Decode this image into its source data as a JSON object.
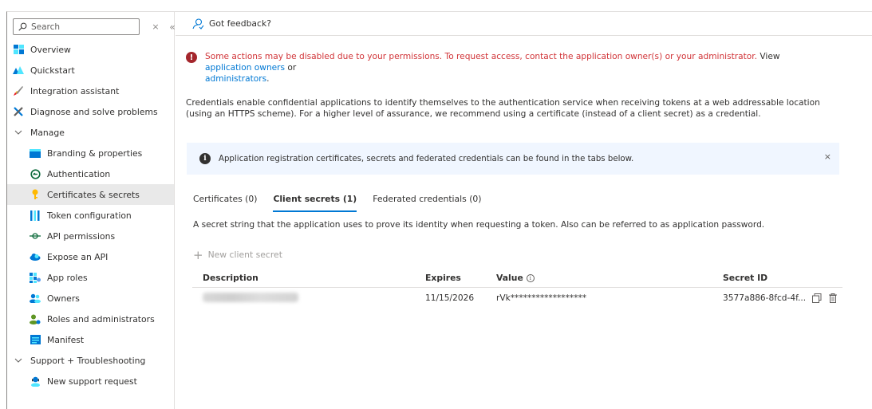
{
  "sidebar": {
    "search": {
      "placeholder": "Search"
    },
    "clear_glyph": "×",
    "collapse_glyph": "«",
    "items": [
      {
        "label": "Overview",
        "icon": "overview-icon"
      },
      {
        "label": "Quickstart",
        "icon": "quickstart-icon"
      },
      {
        "label": "Integration assistant",
        "icon": "rocket-icon"
      },
      {
        "label": "Diagnose and solve problems",
        "icon": "wrench-icon"
      },
      {
        "label": "Manage",
        "icon": "chevron-down-icon"
      },
      {
        "label": "Branding & properties",
        "icon": "branding-icon"
      },
      {
        "label": "Authentication",
        "icon": "authentication-icon"
      },
      {
        "label": "Certificates & secrets",
        "icon": "key-icon"
      },
      {
        "label": "Token configuration",
        "icon": "token-icon"
      },
      {
        "label": "API permissions",
        "icon": "api-permissions-icon"
      },
      {
        "label": "Expose an API",
        "icon": "cloud-icon"
      },
      {
        "label": "App roles",
        "icon": "app-roles-icon"
      },
      {
        "label": "Owners",
        "icon": "owners-icon"
      },
      {
        "label": "Roles and administrators",
        "icon": "roles-icon"
      },
      {
        "label": "Manifest",
        "icon": "manifest-icon"
      },
      {
        "label": "Support + Troubleshooting",
        "icon": "chevron-down-icon"
      },
      {
        "label": "New support request",
        "icon": "support-icon"
      }
    ]
  },
  "cmdbar": {
    "feedback_label": "Got feedback?"
  },
  "warning": {
    "text_red": "Some actions may be disabled due to your permissions. To request access, contact the application owner(s) or your administrator.",
    "text_view": " View ",
    "link_owners": "application owners",
    "text_or": " or ",
    "link_admins": "administrators",
    "text_end": "."
  },
  "description": "Credentials enable confidential applications to identify themselves to the authentication service when receiving tokens at a web addressable location (using an HTTPS scheme). For a higher level of assurance, we recommend using a certificate (instead of a client secret) as a credential.",
  "infobar": {
    "text": "Application registration certificates, secrets and federated credentials can be found in the tabs below.",
    "close_glyph": "×"
  },
  "tabs": [
    {
      "label": "Certificates (0)"
    },
    {
      "label": "Client secrets (1)"
    },
    {
      "label": "Federated credentials (0)"
    }
  ],
  "tab_description": "A secret string that the application uses to prove its identity when requesting a token. Also can be referred to as application password.",
  "new_secret": {
    "plus_glyph": "+",
    "label": "New client secret"
  },
  "table": {
    "headers": {
      "description": "Description",
      "expires": "Expires",
      "value": "Value",
      "value_info_glyph": "i",
      "secret_id": "Secret ID"
    },
    "rows": [
      {
        "description": "",
        "expires": "11/15/2026",
        "value": "rVk******************",
        "secret_id": "3577a886-8fcd-4f..."
      }
    ]
  },
  "colors": {
    "accent": "#0078d4",
    "error": "#d13438",
    "info_bg": "#f0f6ff"
  }
}
